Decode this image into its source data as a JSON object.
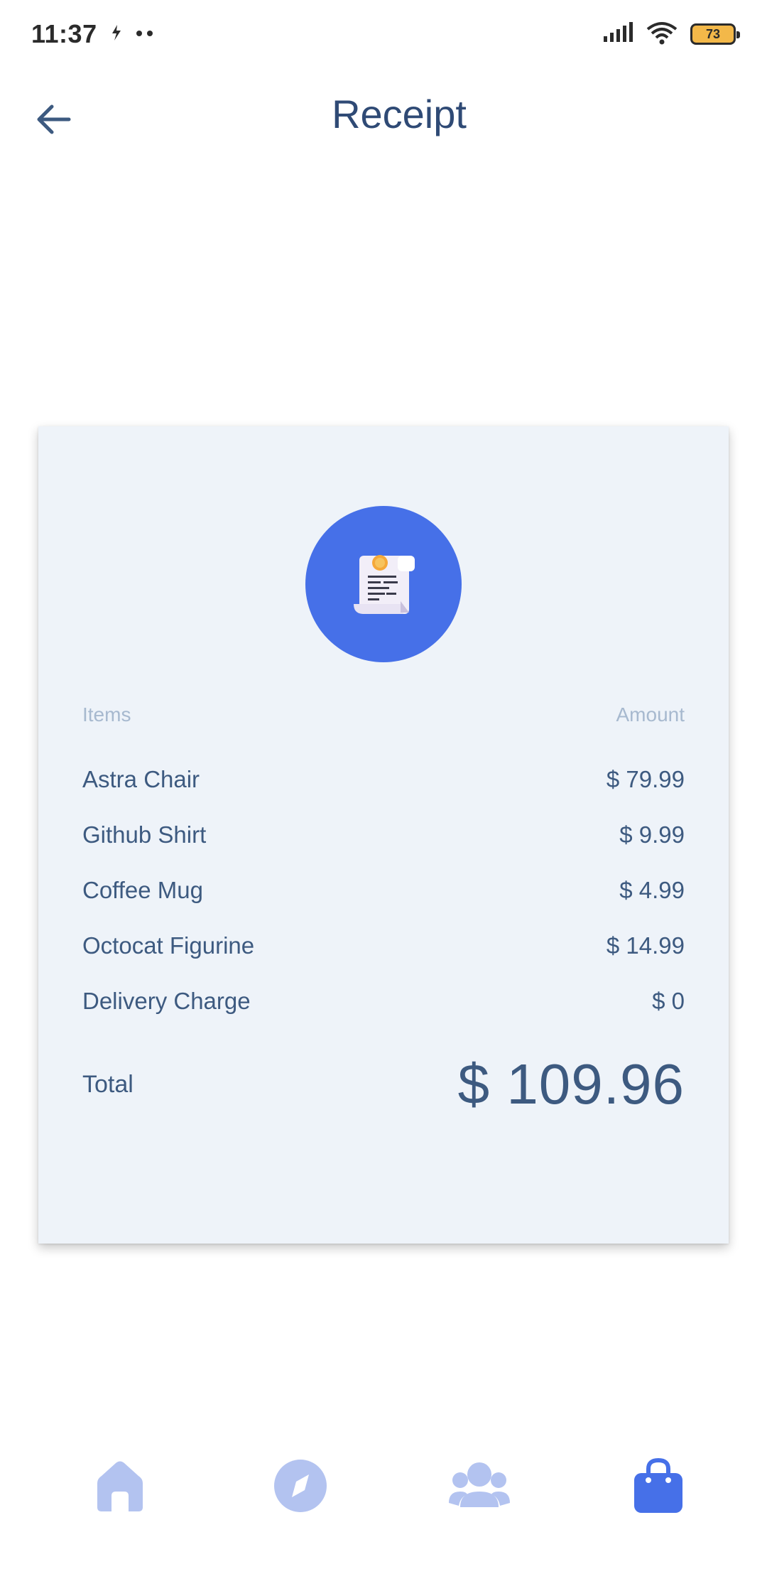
{
  "status_bar": {
    "time": "11:37",
    "battery_level": "73",
    "icons": [
      "signal-icon",
      "wifi-icon",
      "battery-icon"
    ]
  },
  "header": {
    "title": "Receipt",
    "back_icon": "arrow-left-icon"
  },
  "receipt": {
    "badge_icon": "receipt-icon",
    "columns": {
      "items": "Items",
      "amount": "Amount"
    },
    "items": [
      {
        "name": "Astra Chair",
        "amount": "$ 79.99"
      },
      {
        "name": "Github Shirt",
        "amount": "$ 9.99"
      },
      {
        "name": "Coffee Mug",
        "amount": "$ 4.99"
      },
      {
        "name": "Octocat Figurine",
        "amount": "$ 14.99"
      },
      {
        "name": "Delivery Charge",
        "amount": "$ 0"
      }
    ],
    "total_label": "Total",
    "total_value": "$ 109.96"
  },
  "bottom_nav": {
    "items": [
      {
        "icon": "home-icon",
        "active": false
      },
      {
        "icon": "compass-icon",
        "active": false
      },
      {
        "icon": "people-icon",
        "active": false
      },
      {
        "icon": "shopping-bag-icon",
        "active": true
      }
    ]
  },
  "colors": {
    "accent": "#4670e8",
    "inactive": "#b3c3f0",
    "card_bg": "#eef3f9",
    "text": "#3d5a80",
    "muted": "#a7b9cf"
  }
}
